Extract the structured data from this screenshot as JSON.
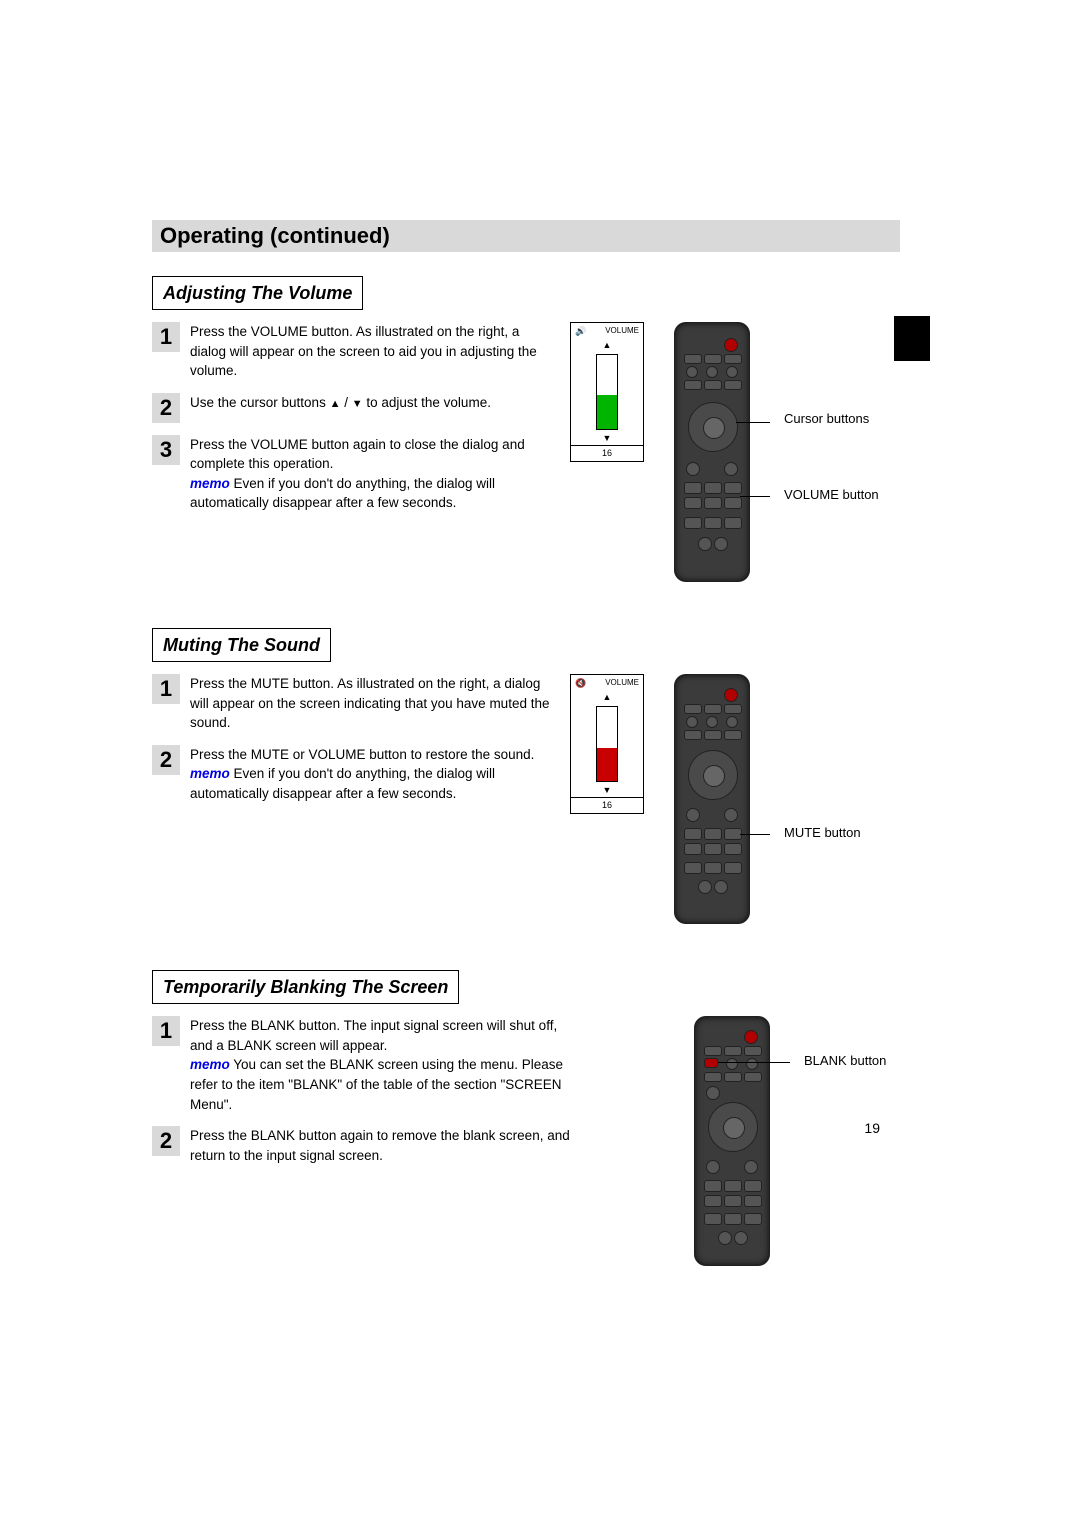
{
  "header": "Operating (continued)",
  "page_number": "19",
  "sections": {
    "volume": {
      "title": "Adjusting The Volume",
      "steps": {
        "s1": {
          "num": "1",
          "text": "Press the VOLUME button.\nAs illustrated on the right, a dialog will appear on the screen to aid you in adjusting the volume."
        },
        "s2": {
          "num": "2",
          "pre": "Use the cursor buttons ",
          "post": " to adjust the volume."
        },
        "s3": {
          "num": "3",
          "text": "Press the VOLUME button again to close the dialog and complete this operation.",
          "memo_label": "memo",
          "memo": " Even if you don't do anything, the dialog will automatically disappear after a few seconds."
        }
      },
      "dialog": {
        "label": "VOLUME",
        "value": "16",
        "up": "▲",
        "down": "▼"
      },
      "callouts": {
        "cursor": "Cursor buttons",
        "volume": "VOLUME button"
      }
    },
    "mute": {
      "title": "Muting The Sound",
      "steps": {
        "s1": {
          "num": "1",
          "text": "Press the MUTE button.\nAs illustrated on the right, a dialog will appear on the screen indicating that you have muted the sound."
        },
        "s2": {
          "num": "2",
          "text": "Press the MUTE or VOLUME button to restore the sound.",
          "memo_label": "memo",
          "memo": " Even if you don't do anything, the dialog will automatically disappear after a few seconds."
        }
      },
      "dialog": {
        "label": "VOLUME",
        "value": "16",
        "up": "▲",
        "down": "▼"
      },
      "callouts": {
        "mute": "MUTE button"
      }
    },
    "blank": {
      "title": "Temporarily Blanking The Screen",
      "steps": {
        "s1": {
          "num": "1",
          "text": "Press the BLANK button.\nThe input signal screen will shut off, and a BLANK screen will appear.",
          "memo_label": "memo",
          "memo": " You can set the BLANK screen using the menu. Please refer to the item \"BLANK\" of the table of the section \"SCREEN Menu\"."
        },
        "s2": {
          "num": "2",
          "text": "Press the BLANK button again to remove the blank screen, and return to the input signal screen."
        }
      },
      "callouts": {
        "blank": "BLANK button"
      }
    }
  },
  "glyphs": {
    "up": "▲",
    "down": "▼",
    "slash": " / "
  }
}
